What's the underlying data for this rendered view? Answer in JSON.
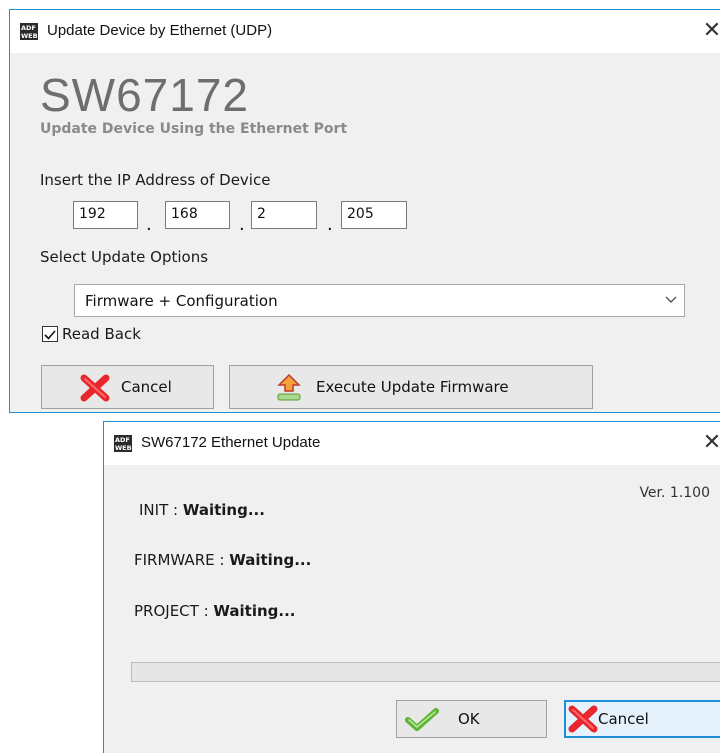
{
  "update_window": {
    "title": "Update Device by Ethernet (UDP)",
    "brand": "SW67172",
    "subtitle": "Update Device Using the Ethernet Port",
    "ip_label": "Insert the IP Address of Device",
    "ip": [
      "192",
      "168",
      "2",
      "205"
    ],
    "ip_separator": ".",
    "options_label": "Select Update Options",
    "option_selected": "Firmware + Configuration",
    "read_back_label": "Read Back",
    "read_back_checked": true,
    "cancel_label": "Cancel",
    "execute_label": "Execute Update Firmware"
  },
  "progress_window": {
    "title": "SW67172 Ethernet Update",
    "version": "Ver. 1.100",
    "init_label": "INIT : ",
    "init_value": "Waiting...",
    "firmware_label": "FIRMWARE : ",
    "firmware_value": "Waiting...",
    "project_label": "PROJECT : ",
    "project_value": "Waiting...",
    "progress": 0,
    "ok_label": "OK",
    "cancel_label": "Cancel"
  },
  "colors": {
    "accent": "#1e8fd6",
    "brand_gray": "#6e6e6e",
    "cancel_x": "#e8262b",
    "ok_check": "#5fb336"
  },
  "icons": [
    "adfweb-app-icon",
    "close-icon",
    "chevron-down-icon",
    "cancel-x-icon",
    "upload-arrow-icon",
    "check-icon"
  ]
}
